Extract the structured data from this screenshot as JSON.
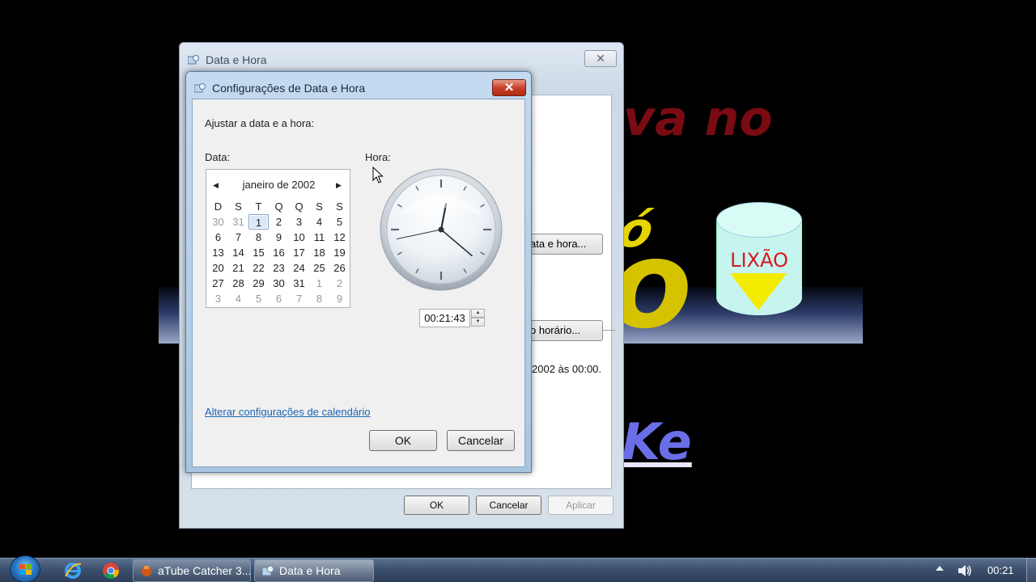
{
  "background": {
    "text_red": "va no",
    "text_yellow_top": "ó",
    "text_yellow_big": "o",
    "text_blue": "Ke",
    "bin_label": "LIXÃO"
  },
  "outer_dialog": {
    "title": "Data e Hora",
    "close_glyph": "✕",
    "partial_date_button": "ata e hora...",
    "partial_timezone_button": "o horário...",
    "partial_text": "2002 às 00:00.",
    "ok": "OK",
    "cancel": "Cancelar",
    "apply": "Aplicar"
  },
  "inner_dialog": {
    "title": "Configurações de Data e Hora",
    "close_glyph": "✕",
    "instruction": "Ajustar a data e a hora:",
    "date_label": "Data:",
    "time_label": "Hora:",
    "calendar": {
      "month_year": "janeiro de 2002",
      "prev_glyph": "◀",
      "next_glyph": "▶",
      "weekdays": [
        "D",
        "S",
        "T",
        "Q",
        "Q",
        "S",
        "S"
      ],
      "weeks": [
        [
          {
            "d": "30",
            "o": true
          },
          {
            "d": "31",
            "o": true
          },
          {
            "d": "1",
            "sel": true
          },
          {
            "d": "2"
          },
          {
            "d": "3"
          },
          {
            "d": "4"
          },
          {
            "d": "5"
          }
        ],
        [
          {
            "d": "6"
          },
          {
            "d": "7"
          },
          {
            "d": "8"
          },
          {
            "d": "9"
          },
          {
            "d": "10"
          },
          {
            "d": "11"
          },
          {
            "d": "12"
          }
        ],
        [
          {
            "d": "13"
          },
          {
            "d": "14"
          },
          {
            "d": "15"
          },
          {
            "d": "16"
          },
          {
            "d": "17"
          },
          {
            "d": "18"
          },
          {
            "d": "19"
          }
        ],
        [
          {
            "d": "20"
          },
          {
            "d": "21"
          },
          {
            "d": "22"
          },
          {
            "d": "23"
          },
          {
            "d": "24"
          },
          {
            "d": "25"
          },
          {
            "d": "26"
          }
        ],
        [
          {
            "d": "27"
          },
          {
            "d": "28"
          },
          {
            "d": "29"
          },
          {
            "d": "30"
          },
          {
            "d": "31"
          },
          {
            "d": "1",
            "o": true
          },
          {
            "d": "2",
            "o": true
          }
        ],
        [
          {
            "d": "3",
            "o": true
          },
          {
            "d": "4",
            "o": true
          },
          {
            "d": "5",
            "o": true
          },
          {
            "d": "6",
            "o": true
          },
          {
            "d": "7",
            "o": true
          },
          {
            "d": "8",
            "o": true
          },
          {
            "d": "9",
            "o": true
          }
        ]
      ]
    },
    "clock": {
      "hour": 0,
      "minute": 21,
      "second": 43
    },
    "time_value": "00:21:43",
    "change_calendar_link": "Alterar configurações de calendário",
    "ok": "OK",
    "cancel": "Cancelar"
  },
  "taskbar": {
    "tasks": [
      {
        "label": "aTube Catcher 3...",
        "icon": "atube-icon"
      },
      {
        "label": "Data e Hora",
        "icon": "date-time-icon"
      }
    ],
    "clock": "00:21"
  },
  "colors": {
    "accent_link": "#1a63b5",
    "close_red": "#c8402a",
    "taskbar": "#3a4e6c"
  }
}
